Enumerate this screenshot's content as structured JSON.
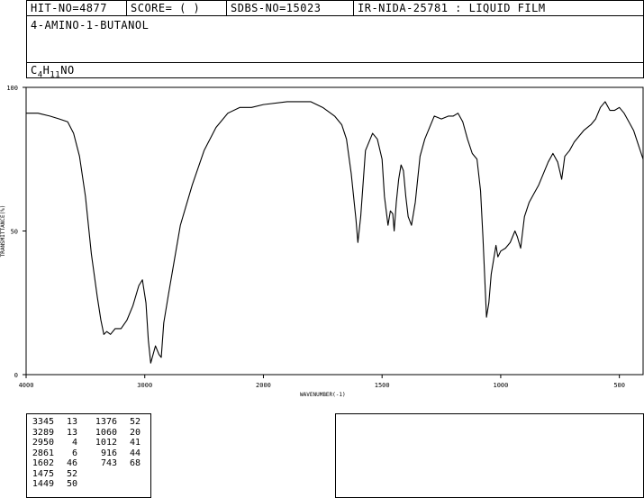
{
  "header": {
    "hit_no": "HIT-NO=4877",
    "score": "SCORE=  (   )",
    "sdbs_no": "SDBS-NO=15023",
    "ir_info": "IR-NIDA-25781 : LIQUID FILM"
  },
  "compound": {
    "name": "4-AMINO-1-BUTANOL",
    "formula_parts": [
      "C",
      "4",
      "H",
      "11",
      "NO"
    ]
  },
  "chart_data": {
    "type": "line",
    "xlabel": "WAVENUMBER(-1)",
    "ylabel": "TRANSMITTANCE(%)",
    "xlim": [
      4000,
      400
    ],
    "ylim": [
      0,
      100
    ],
    "xticks": [
      4000,
      3000,
      2000,
      1500,
      1000,
      500
    ],
    "yticks": [
      0,
      50,
      100
    ],
    "series": [
      {
        "x": [
          4000,
          3900,
          3800,
          3720,
          3650,
          3600,
          3550,
          3500,
          3450,
          3400,
          3370,
          3345,
          3320,
          3289,
          3250,
          3200,
          3150,
          3100,
          3050,
          3020,
          2990,
          2970,
          2950,
          2930,
          2910,
          2880,
          2861,
          2840,
          2800,
          2750,
          2700,
          2600,
          2500,
          2400,
          2300,
          2200,
          2100,
          2000,
          1900,
          1800,
          1750,
          1700,
          1670,
          1650,
          1630,
          1610,
          1602,
          1590,
          1570,
          1540,
          1520,
          1500,
          1490,
          1475,
          1465,
          1455,
          1449,
          1440,
          1430,
          1420,
          1410,
          1400,
          1390,
          1376,
          1360,
          1340,
          1320,
          1300,
          1280,
          1250,
          1220,
          1200,
          1180,
          1160,
          1140,
          1120,
          1100,
          1085,
          1075,
          1060,
          1050,
          1040,
          1030,
          1020,
          1012,
          1000,
          980,
          960,
          940,
          930,
          916,
          900,
          880,
          860,
          840,
          820,
          800,
          780,
          760,
          743,
          730,
          710,
          690,
          670,
          650,
          620,
          600,
          580,
          560,
          540,
          520,
          500,
          480,
          460,
          440,
          420,
          400
        ],
        "y": [
          91,
          91,
          90,
          89,
          88,
          84,
          76,
          62,
          42,
          27,
          19,
          14,
          15,
          14,
          16,
          16,
          19,
          24,
          31,
          33,
          25,
          12,
          4,
          7,
          10,
          7,
          6,
          18,
          28,
          40,
          52,
          66,
          78,
          86,
          91,
          93,
          93,
          94,
          95,
          95,
          93,
          90,
          87,
          82,
          70,
          54,
          46,
          55,
          78,
          84,
          82,
          75,
          62,
          52,
          57,
          56,
          50,
          60,
          68,
          73,
          71,
          62,
          55,
          52,
          60,
          76,
          82,
          86,
          90,
          89,
          90,
          90,
          91,
          88,
          82,
          77,
          75,
          64,
          48,
          20,
          25,
          35,
          40,
          45,
          41,
          43,
          44,
          46,
          50,
          48,
          44,
          55,
          60,
          63,
          66,
          70,
          74,
          77,
          74,
          68,
          76,
          78,
          81,
          83,
          85,
          87,
          89,
          93,
          95,
          92,
          92,
          93,
          91,
          88,
          85,
          80,
          75
        ]
      }
    ]
  },
  "peaks": {
    "col1": [
      [
        "3345",
        "13"
      ],
      [
        "3289",
        "13"
      ],
      [
        "2950",
        "4"
      ],
      [
        "2861",
        "6"
      ],
      [
        "1602",
        "46"
      ],
      [
        "1475",
        "52"
      ],
      [
        "1449",
        "50"
      ]
    ],
    "col2": [
      [
        "1376",
        "52"
      ],
      [
        "1060",
        "20"
      ],
      [
        "1012",
        "41"
      ],
      [
        "916",
        "44"
      ],
      [
        "743",
        "68"
      ]
    ]
  }
}
